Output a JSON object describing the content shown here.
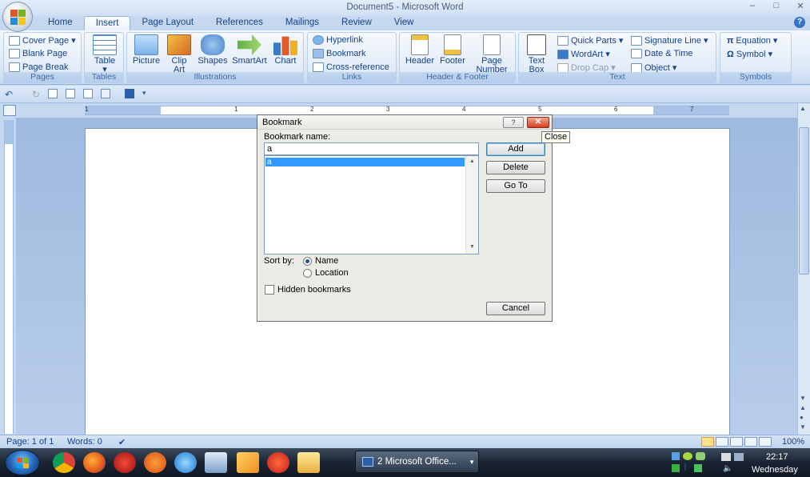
{
  "window": {
    "title": "Document5 - Microsoft Word",
    "controls": [
      "–",
      "□",
      "✕"
    ]
  },
  "tabs": [
    "Home",
    "Insert",
    "Page Layout",
    "References",
    "Mailings",
    "Review",
    "View"
  ],
  "ribbon": {
    "pages": {
      "label": "Pages",
      "items": [
        "Cover Page ▾",
        "Blank Page",
        "Page Break"
      ]
    },
    "tables": {
      "label": "Tables",
      "items": [
        "Table ▾"
      ]
    },
    "illustrations": {
      "label": "Illustrations",
      "items": [
        "Picture",
        "Clip Art",
        "Shapes",
        "SmartArt",
        "Chart"
      ]
    },
    "links": {
      "label": "Links",
      "items": [
        "Hyperlink",
        "Bookmark",
        "Cross-reference"
      ]
    },
    "header_footer": {
      "label": "Header & Footer",
      "items": [
        "Header",
        "Footer",
        "Page Number"
      ]
    },
    "text": {
      "label": "Text",
      "items": [
        "Text Box",
        "Quick Parts ▾",
        "WordArt ▾",
        "Drop Cap ▾",
        "Signature Line ▾",
        "Date & Time",
        "Object ▾"
      ]
    },
    "symbols": {
      "label": "Symbols",
      "items": [
        "Equation ▾",
        "Symbol ▾"
      ]
    }
  },
  "ruler": {
    "numbers": [
      "1",
      "1",
      "2",
      "3",
      "4",
      "5",
      "6",
      "7"
    ]
  },
  "dialog": {
    "title": "Bookmark",
    "help": "?",
    "close": "✕",
    "name_label": "Bookmark name:",
    "name_value": "a",
    "list_items": [
      "a"
    ],
    "buttons": {
      "add": "Add",
      "delete": "Delete",
      "goto": "Go To",
      "cancel": "Cancel"
    },
    "sort_label": "Sort by:",
    "sort_options": [
      "Name",
      "Location"
    ],
    "sort_selected": "Name",
    "hidden_label": "Hidden bookmarks",
    "hidden_checked": false
  },
  "tooltip": "Close",
  "status": {
    "page": "Page: 1 of 1",
    "words": "Words: 0",
    "zoom": "100%"
  },
  "taskbar": {
    "task_label": "2 Microsoft Office...",
    "time": "22:17",
    "day": "Wednesday"
  }
}
